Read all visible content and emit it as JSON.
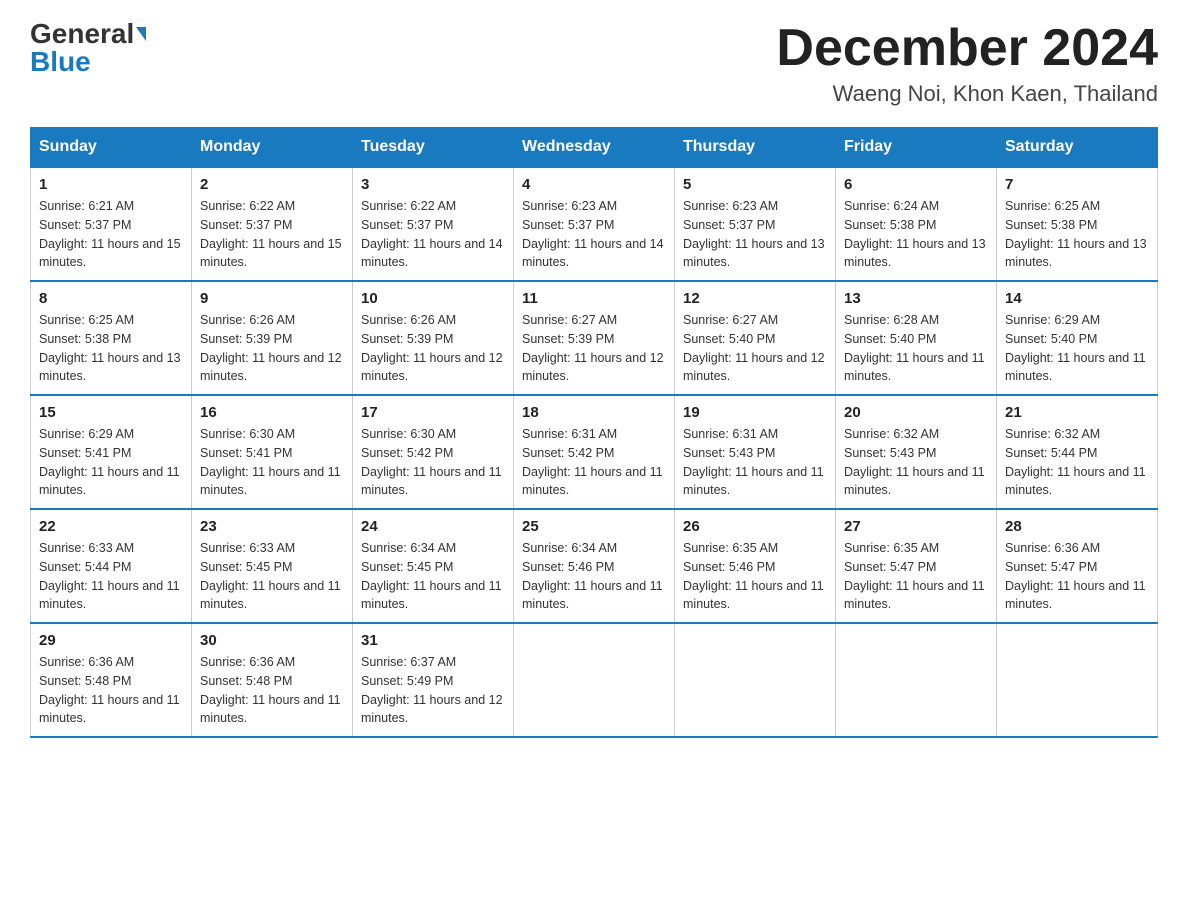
{
  "header": {
    "logo_general": "General",
    "logo_blue": "Blue",
    "title": "December 2024",
    "subtitle": "Waeng Noi, Khon Kaen, Thailand"
  },
  "days_of_week": [
    "Sunday",
    "Monday",
    "Tuesday",
    "Wednesday",
    "Thursday",
    "Friday",
    "Saturday"
  ],
  "weeks": [
    [
      {
        "day": "1",
        "sunrise": "6:21 AM",
        "sunset": "5:37 PM",
        "daylight": "11 hours and 15 minutes."
      },
      {
        "day": "2",
        "sunrise": "6:22 AM",
        "sunset": "5:37 PM",
        "daylight": "11 hours and 15 minutes."
      },
      {
        "day": "3",
        "sunrise": "6:22 AM",
        "sunset": "5:37 PM",
        "daylight": "11 hours and 14 minutes."
      },
      {
        "day": "4",
        "sunrise": "6:23 AM",
        "sunset": "5:37 PM",
        "daylight": "11 hours and 14 minutes."
      },
      {
        "day": "5",
        "sunrise": "6:23 AM",
        "sunset": "5:37 PM",
        "daylight": "11 hours and 13 minutes."
      },
      {
        "day": "6",
        "sunrise": "6:24 AM",
        "sunset": "5:38 PM",
        "daylight": "11 hours and 13 minutes."
      },
      {
        "day": "7",
        "sunrise": "6:25 AM",
        "sunset": "5:38 PM",
        "daylight": "11 hours and 13 minutes."
      }
    ],
    [
      {
        "day": "8",
        "sunrise": "6:25 AM",
        "sunset": "5:38 PM",
        "daylight": "11 hours and 13 minutes."
      },
      {
        "day": "9",
        "sunrise": "6:26 AM",
        "sunset": "5:39 PM",
        "daylight": "11 hours and 12 minutes."
      },
      {
        "day": "10",
        "sunrise": "6:26 AM",
        "sunset": "5:39 PM",
        "daylight": "11 hours and 12 minutes."
      },
      {
        "day": "11",
        "sunrise": "6:27 AM",
        "sunset": "5:39 PM",
        "daylight": "11 hours and 12 minutes."
      },
      {
        "day": "12",
        "sunrise": "6:27 AM",
        "sunset": "5:40 PM",
        "daylight": "11 hours and 12 minutes."
      },
      {
        "day": "13",
        "sunrise": "6:28 AM",
        "sunset": "5:40 PM",
        "daylight": "11 hours and 11 minutes."
      },
      {
        "day": "14",
        "sunrise": "6:29 AM",
        "sunset": "5:40 PM",
        "daylight": "11 hours and 11 minutes."
      }
    ],
    [
      {
        "day": "15",
        "sunrise": "6:29 AM",
        "sunset": "5:41 PM",
        "daylight": "11 hours and 11 minutes."
      },
      {
        "day": "16",
        "sunrise": "6:30 AM",
        "sunset": "5:41 PM",
        "daylight": "11 hours and 11 minutes."
      },
      {
        "day": "17",
        "sunrise": "6:30 AM",
        "sunset": "5:42 PM",
        "daylight": "11 hours and 11 minutes."
      },
      {
        "day": "18",
        "sunrise": "6:31 AM",
        "sunset": "5:42 PM",
        "daylight": "11 hours and 11 minutes."
      },
      {
        "day": "19",
        "sunrise": "6:31 AM",
        "sunset": "5:43 PM",
        "daylight": "11 hours and 11 minutes."
      },
      {
        "day": "20",
        "sunrise": "6:32 AM",
        "sunset": "5:43 PM",
        "daylight": "11 hours and 11 minutes."
      },
      {
        "day": "21",
        "sunrise": "6:32 AM",
        "sunset": "5:44 PM",
        "daylight": "11 hours and 11 minutes."
      }
    ],
    [
      {
        "day": "22",
        "sunrise": "6:33 AM",
        "sunset": "5:44 PM",
        "daylight": "11 hours and 11 minutes."
      },
      {
        "day": "23",
        "sunrise": "6:33 AM",
        "sunset": "5:45 PM",
        "daylight": "11 hours and 11 minutes."
      },
      {
        "day": "24",
        "sunrise": "6:34 AM",
        "sunset": "5:45 PM",
        "daylight": "11 hours and 11 minutes."
      },
      {
        "day": "25",
        "sunrise": "6:34 AM",
        "sunset": "5:46 PM",
        "daylight": "11 hours and 11 minutes."
      },
      {
        "day": "26",
        "sunrise": "6:35 AM",
        "sunset": "5:46 PM",
        "daylight": "11 hours and 11 minutes."
      },
      {
        "day": "27",
        "sunrise": "6:35 AM",
        "sunset": "5:47 PM",
        "daylight": "11 hours and 11 minutes."
      },
      {
        "day": "28",
        "sunrise": "6:36 AM",
        "sunset": "5:47 PM",
        "daylight": "11 hours and 11 minutes."
      }
    ],
    [
      {
        "day": "29",
        "sunrise": "6:36 AM",
        "sunset": "5:48 PM",
        "daylight": "11 hours and 11 minutes."
      },
      {
        "day": "30",
        "sunrise": "6:36 AM",
        "sunset": "5:48 PM",
        "daylight": "11 hours and 11 minutes."
      },
      {
        "day": "31",
        "sunrise": "6:37 AM",
        "sunset": "5:49 PM",
        "daylight": "11 hours and 12 minutes."
      },
      null,
      null,
      null,
      null
    ]
  ],
  "labels": {
    "sunrise_prefix": "Sunrise: ",
    "sunset_prefix": "Sunset: ",
    "daylight_prefix": "Daylight: "
  }
}
